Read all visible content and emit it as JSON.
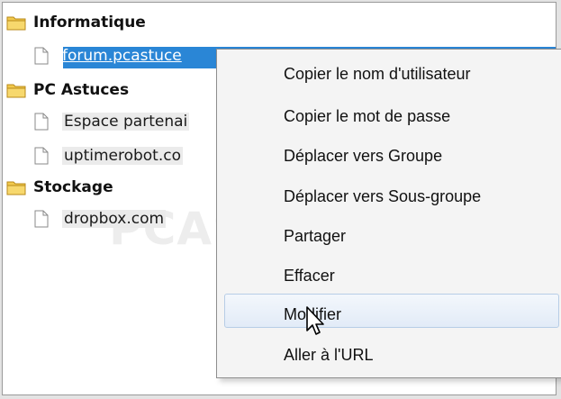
{
  "tree": {
    "groups": [
      {
        "label": "Informatique",
        "items": [
          {
            "label": "forum.pcastuce",
            "selected": true
          }
        ]
      },
      {
        "label": "PC Astuces",
        "items": [
          {
            "label": "Espace partenai"
          },
          {
            "label": "uptimerobot.co"
          }
        ]
      },
      {
        "label": "Stockage",
        "items": [
          {
            "label": "dropbox.com"
          }
        ]
      }
    ]
  },
  "watermark": "PCASTUCES",
  "context_menu": {
    "items": [
      "Copier le nom d'utilisateur",
      "Copier le mot de passe",
      "Déplacer vers Groupe",
      "Déplacer vers Sous-groupe",
      "Partager",
      "Effacer",
      "Modifier",
      "Aller à l'URL"
    ],
    "hovered_item": "Modifier"
  },
  "colors": {
    "selection": "#2a86d6",
    "folder": "#f2c94c",
    "menu_hover": "#e2ebf7"
  },
  "icons": {
    "group": "folder-icon",
    "entry": "document-icon",
    "pointer": "mouse-cursor-icon"
  }
}
